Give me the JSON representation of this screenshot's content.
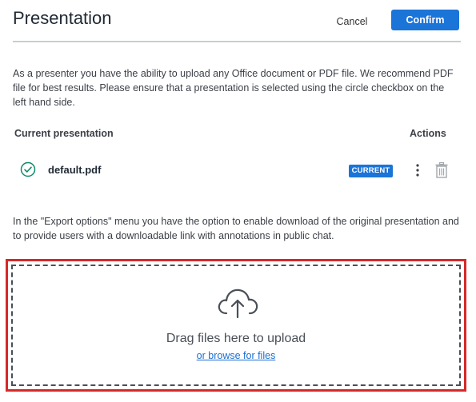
{
  "header": {
    "title": "Presentation",
    "cancel_label": "Cancel",
    "confirm_label": "Confirm"
  },
  "intro_text": "As a presenter you have the ability to upload any Office document or PDF file. We recommend PDF file for best results. Please ensure that a presentation is selected using the circle checkbox on the left hand side.",
  "table": {
    "current_header": "Current presentation",
    "actions_header": "Actions",
    "rows": [
      {
        "file_name": "default.pdf",
        "badge": "CURRENT",
        "selected": true,
        "icons": [
          "check-circle-icon",
          "more-vertical-icon",
          "trash-icon"
        ]
      }
    ]
  },
  "export_text": "In the \"Export options\" menu you have the option to enable download of the original presentation and to provide users with a downloadable link with annotations in public chat.",
  "dropzone": {
    "icon": "cloud-upload-icon",
    "primary_text": "Drag files here to upload",
    "browse_text": "or browse for files"
  },
  "colors": {
    "accent": "#1b74d8",
    "highlight_border": "#d62828",
    "check": "#0f8a6c"
  }
}
